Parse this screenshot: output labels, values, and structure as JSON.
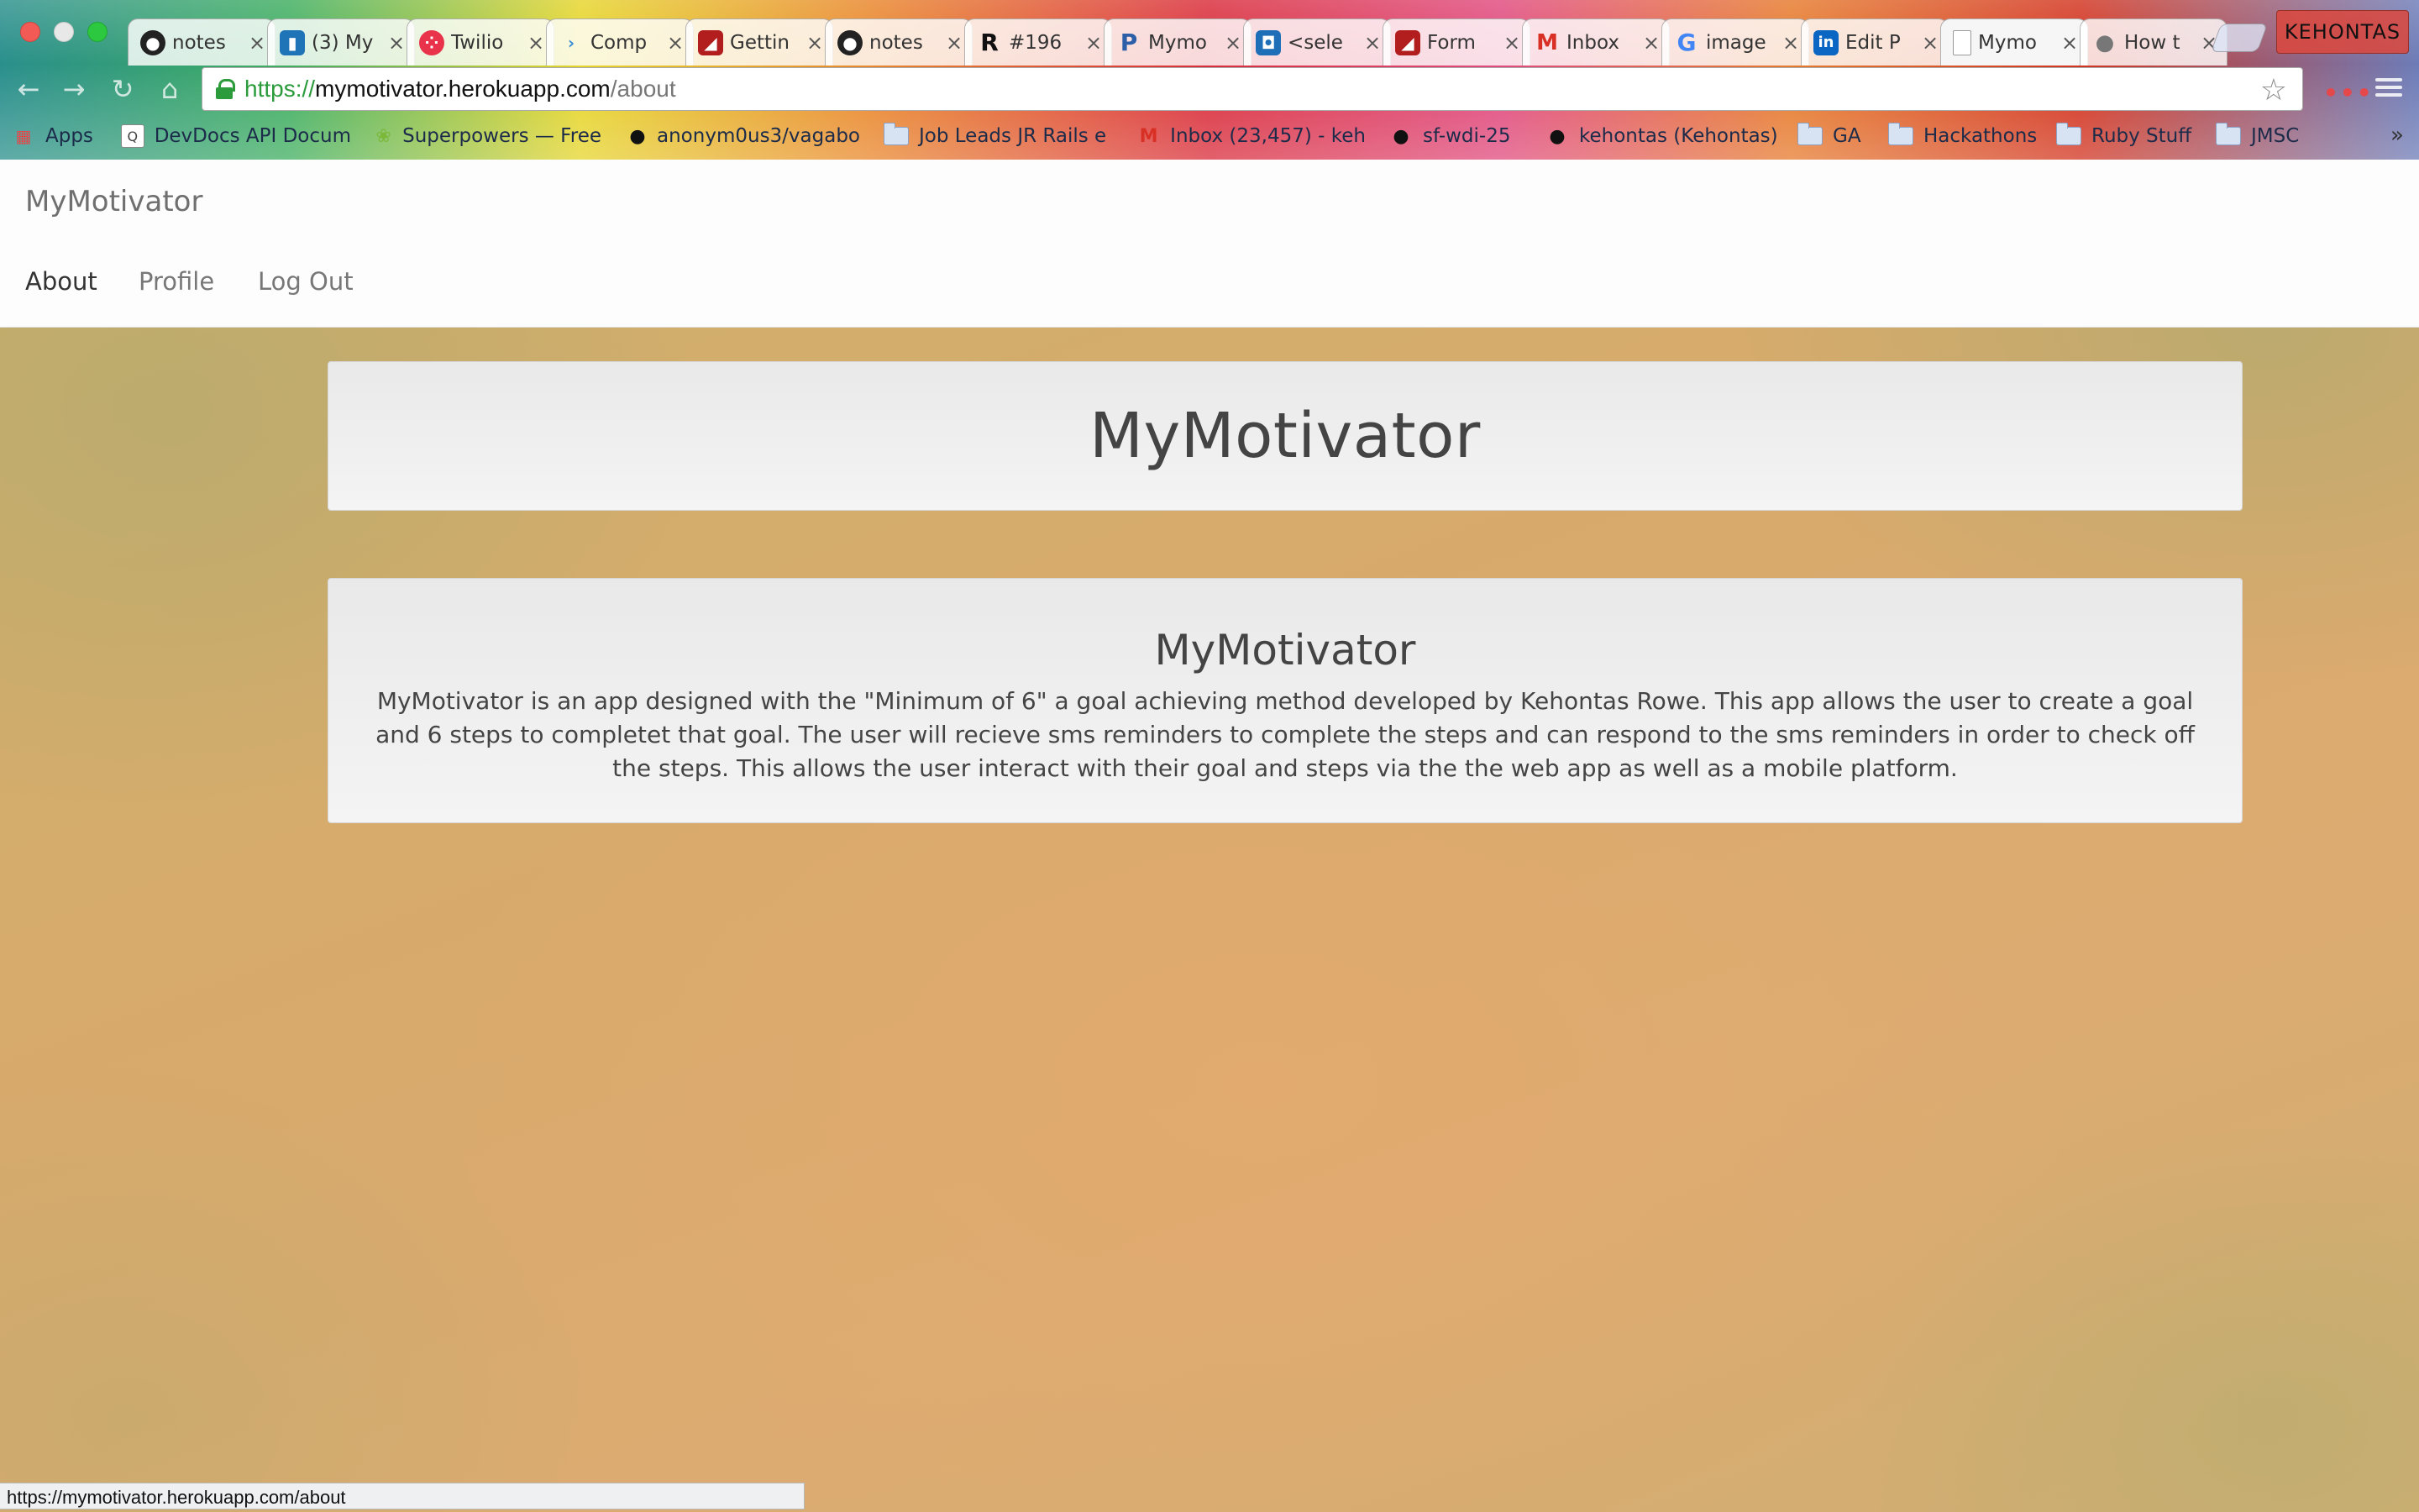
{
  "browser": {
    "tabs": [
      {
        "title": "notes",
        "icon": "github-icon",
        "active": false
      },
      {
        "title": "(3) My",
        "icon": "trello-icon",
        "active": false
      },
      {
        "title": "Twilio",
        "icon": "twilio-icon",
        "active": false
      },
      {
        "title": "Comp",
        "icon": "compiler-icon",
        "active": false
      },
      {
        "title": "Gettin",
        "icon": "rails-icon",
        "active": false
      },
      {
        "title": "notes",
        "icon": "github-icon",
        "active": false
      },
      {
        "title": "#196",
        "icon": "railscasts-icon",
        "active": false
      },
      {
        "title": "Mymo",
        "icon": "pivotal-icon",
        "active": false
      },
      {
        "title": "<sele",
        "icon": "select-icon",
        "active": false
      },
      {
        "title": "Form",
        "icon": "rails-icon",
        "active": false
      },
      {
        "title": "Inbox",
        "icon": "gmail-icon",
        "active": false
      },
      {
        "title": "image",
        "icon": "google-icon",
        "active": false
      },
      {
        "title": "Edit P",
        "icon": "linkedin-icon",
        "active": false
      },
      {
        "title": "Mymo",
        "icon": "page-icon",
        "active": true
      },
      {
        "title": "How t",
        "icon": "apple-icon",
        "active": false
      }
    ],
    "profile_name": "KEHONTAS",
    "url": {
      "scheme": "https://",
      "host": "mymotivator.herokuapp.com",
      "path": "/about"
    },
    "bookmarks": [
      {
        "label": "Apps",
        "icon": "apps-grid-icon"
      },
      {
        "label": "DevDocs API Docum",
        "icon": "devdocs-icon"
      },
      {
        "label": "Superpowers — Free",
        "icon": "superpowers-icon"
      },
      {
        "label": "anonym0us3/vagabo",
        "icon": "github-icon"
      },
      {
        "label": "Job Leads JR Rails e",
        "icon": "folder-icon"
      },
      {
        "label": "Inbox (23,457) - keh",
        "icon": "gmail-icon"
      },
      {
        "label": "sf-wdi-25",
        "icon": "github-icon"
      },
      {
        "label": "kehontas (Kehontas)",
        "icon": "github-icon"
      },
      {
        "label": "GA",
        "icon": "folder-icon"
      },
      {
        "label": "Hackathons",
        "icon": "folder-icon"
      },
      {
        "label": "Ruby Stuff",
        "icon": "folder-icon"
      },
      {
        "label": "JMSC",
        "icon": "folder-icon"
      }
    ],
    "bookmarks_overflow": "»",
    "status_url": "https://mymotivator.herokuapp.com/about"
  },
  "site": {
    "brand": "MyMotivator",
    "nav": [
      {
        "label": "About",
        "active": true
      },
      {
        "label": "Profile",
        "active": false
      },
      {
        "label": "Log Out",
        "active": false
      }
    ],
    "jumbotron_title": "MyMotivator",
    "about": {
      "heading": "MyMotivator",
      "body": "MyMotivator is an app designed with the \"Minimum of 6\" a goal achieving method developed by Kehontas Rowe. This app allows the user to create a goal and 6 steps to completet that goal. The user will recieve sms reminders to complete the steps and can respond to the sms reminders in order to check off the steps. This allows the user interact with their goal and steps via the the web app as well as a mobile platform."
    }
  }
}
